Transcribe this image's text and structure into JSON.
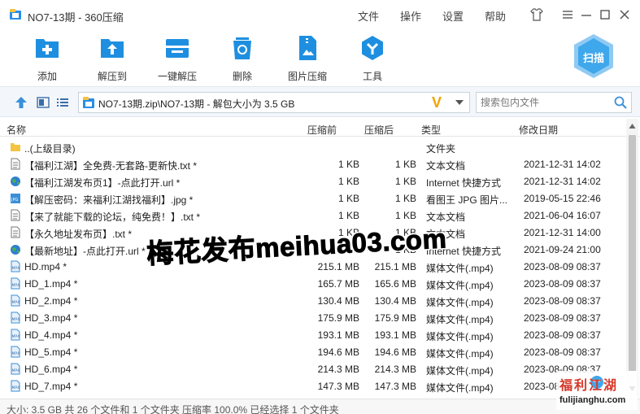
{
  "window": {
    "title": "NO7-13期 - 360压缩",
    "menu": [
      "文件",
      "操作",
      "设置",
      "帮助"
    ]
  },
  "toolbar": {
    "buttons": [
      {
        "label": "添加",
        "icon": "add-icon"
      },
      {
        "label": "解压到",
        "icon": "extract-to-icon"
      },
      {
        "label": "一键解压",
        "icon": "one-click-extract-icon"
      },
      {
        "label": "删除",
        "icon": "delete-icon"
      },
      {
        "label": "图片压缩",
        "icon": "image-compress-icon"
      },
      {
        "label": "工具",
        "icon": "tools-icon"
      }
    ],
    "scan_label": "扫描"
  },
  "addressbar": {
    "path": "NO7-13期.zip\\NO7-13期 - 解包大小为 3.5 GB",
    "search_placeholder": "搜索包内文件"
  },
  "columns": {
    "name": "名称",
    "compressed": "压缩前",
    "uncompressed": "压缩后",
    "type": "类型",
    "modified": "修改日期"
  },
  "files": [
    {
      "name": "..(上级目录)",
      "compressed": "",
      "uncompressed": "",
      "type": "文件夹",
      "date": "",
      "icon": "folder-icon"
    },
    {
      "name": "【福利江湖】全免费-无套路-更新快.txt *",
      "compressed": "1 KB",
      "uncompressed": "1 KB",
      "type": "文本文档",
      "date": "2021-12-31 14:02",
      "icon": "text-file-icon"
    },
    {
      "name": "【福利江湖发布页1】-点此打开.url *",
      "compressed": "1 KB",
      "uncompressed": "1 KB",
      "type": "Internet 快捷方式",
      "date": "2021-12-31 14:02",
      "icon": "globe-icon"
    },
    {
      "name": "【解压密码：来福利江湖找福利】.jpg *",
      "compressed": "1 KB",
      "uncompressed": "1 KB",
      "type": "看图王 JPG 图片...",
      "date": "2019-05-15 22:46",
      "icon": "jpg-file-icon"
    },
    {
      "name": "【来了就能下载的论坛，纯免费！】.txt *",
      "compressed": "1 KB",
      "uncompressed": "1 KB",
      "type": "文本文档",
      "date": "2021-06-04 16:07",
      "icon": "text-file-icon"
    },
    {
      "name": "【永久地址发布页】.txt *",
      "compressed": "1 KB",
      "uncompressed": "1 KB",
      "type": "文本文档",
      "date": "2021-12-31 14:00",
      "icon": "text-file-icon"
    },
    {
      "name": "【最新地址】-点此打开.url *",
      "compressed": "1 KB",
      "uncompressed": "1 KB",
      "type": "Internet 快捷方式",
      "date": "2021-09-24 21:00",
      "icon": "globe-icon"
    },
    {
      "name": "HD.mp4 *",
      "compressed": "215.1 MB",
      "uncompressed": "215.1 MB",
      "type": "媒体文件(.mp4)",
      "date": "2023-08-09 08:37",
      "icon": "mp4-file-icon"
    },
    {
      "name": "HD_1.mp4 *",
      "compressed": "165.7 MB",
      "uncompressed": "165.6 MB",
      "type": "媒体文件(.mp4)",
      "date": "2023-08-09 08:37",
      "icon": "mp4-file-icon"
    },
    {
      "name": "HD_2.mp4 *",
      "compressed": "130.4 MB",
      "uncompressed": "130.4 MB",
      "type": "媒体文件(.mp4)",
      "date": "2023-08-09 08:37",
      "icon": "mp4-file-icon"
    },
    {
      "name": "HD_3.mp4 *",
      "compressed": "175.9 MB",
      "uncompressed": "175.9 MB",
      "type": "媒体文件(.mp4)",
      "date": "2023-08-09 08:37",
      "icon": "mp4-file-icon"
    },
    {
      "name": "HD_4.mp4 *",
      "compressed": "193.1 MB",
      "uncompressed": "193.1 MB",
      "type": "媒体文件(.mp4)",
      "date": "2023-08-09 08:37",
      "icon": "mp4-file-icon"
    },
    {
      "name": "HD_5.mp4 *",
      "compressed": "194.6 MB",
      "uncompressed": "194.6 MB",
      "type": "媒体文件(.mp4)",
      "date": "2023-08-09 08:37",
      "icon": "mp4-file-icon"
    },
    {
      "name": "HD_6.mp4 *",
      "compressed": "214.3 MB",
      "uncompressed": "214.3 MB",
      "type": "媒体文件(.mp4)",
      "date": "2023-08-09 08:37",
      "icon": "mp4-file-icon"
    },
    {
      "name": "HD_7.mp4 *",
      "compressed": "147.3 MB",
      "uncompressed": "147.3 MB",
      "type": "媒体文件(.mp4)",
      "date": "2023-08-09 08:37",
      "icon": "mp4-file-icon"
    }
  ],
  "status": "大小: 3.5 GB 共 26 个文件和 1 个文件夹 压缩率 100.0% 已经选择 1 个文件夹",
  "watermark": "梅花发布meihua03.com",
  "corner_logo": {
    "title": "福利江湖",
    "url": "fulijianghu.com"
  },
  "colors": {
    "accent": "#1e8fe0",
    "folder": "#f5c342",
    "scan": "#3fa7ec"
  }
}
